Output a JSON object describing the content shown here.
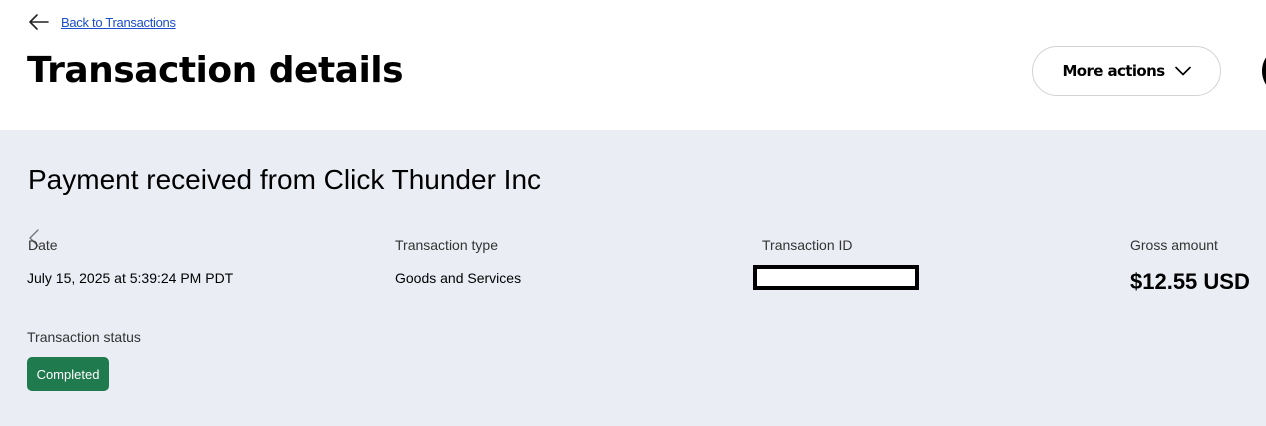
{
  "header": {
    "back_label": "Back to Transactions",
    "title": "Transaction details",
    "more_actions_label": "More actions"
  },
  "transaction": {
    "title": "Payment received from Click Thunder Inc",
    "date_label": "Date",
    "date_value": "July 15, 2025 at 5:39:24 PM PDT",
    "type_label": "Transaction type",
    "type_value": "Goods and Services",
    "id_label": "Transaction ID",
    "gross_label": "Gross amount",
    "gross_value": "$12.55 USD",
    "status_label": "Transaction status",
    "status_value": "Completed"
  },
  "colors": {
    "link": "#1a4ecf",
    "panel_background": "#eaeef4",
    "status_completed": "#1f7a4d"
  },
  "icons": {
    "back": "arrow-left-icon",
    "more_actions": "chevron-down-icon",
    "panel_toggle": "chevron-left-icon"
  }
}
